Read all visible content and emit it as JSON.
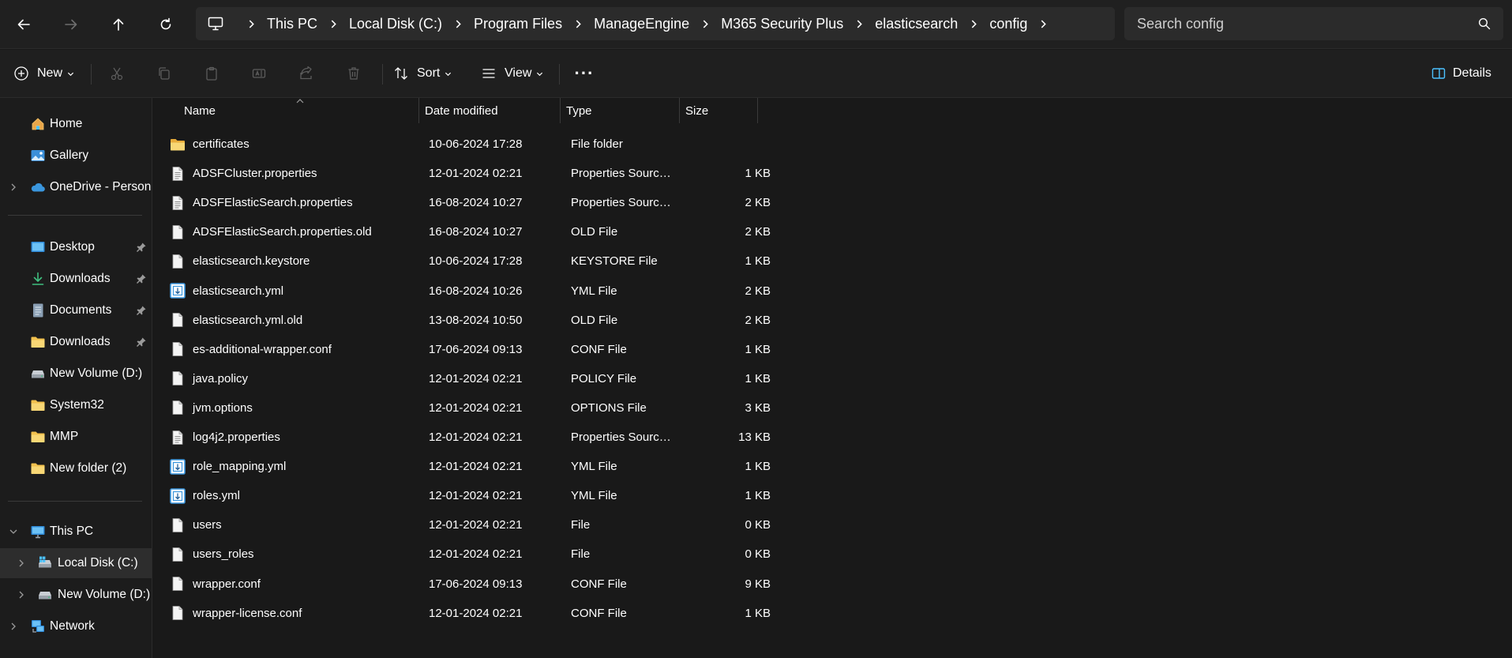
{
  "navigation": {
    "back_icon": "arrow-left-icon",
    "forward_icon": "arrow-right-icon",
    "up_icon": "arrow-up-icon",
    "refresh_icon": "refresh-icon"
  },
  "breadcrumb": [
    "This PC",
    "Local Disk (C:)",
    "Program Files",
    "ManageEngine",
    "M365 Security Plus",
    "elasticsearch",
    "config"
  ],
  "search": {
    "placeholder": "Search config"
  },
  "toolbar": {
    "new_label": "New",
    "sort_label": "Sort",
    "view_label": "View",
    "more_label": "···",
    "details_label": "Details"
  },
  "sidebar": {
    "home": "Home",
    "gallery": "Gallery",
    "onedrive": "OneDrive - Persona",
    "quick_access": [
      {
        "label": "Desktop",
        "icon": "desktop-icon",
        "pinned": true
      },
      {
        "label": "Downloads",
        "icon": "download-icon",
        "pinned": true
      },
      {
        "label": "Documents",
        "icon": "documents-icon",
        "pinned": true
      },
      {
        "label": "Downloads",
        "icon": "folder-icon",
        "pinned": true
      },
      {
        "label": "New Volume (D:)",
        "icon": "drive-icon",
        "pinned": false
      },
      {
        "label": "System32",
        "icon": "folder-icon",
        "pinned": false
      },
      {
        "label": "MMP",
        "icon": "folder-icon",
        "pinned": false
      },
      {
        "label": "New folder (2)",
        "icon": "folder-icon",
        "pinned": false
      }
    ],
    "this_pc": "This PC",
    "local_disk": "Local Disk (C:)",
    "new_volume": "New Volume (D:)",
    "network": "Network"
  },
  "columns": {
    "name": "Name",
    "date": "Date modified",
    "type": "Type",
    "size": "Size"
  },
  "files": [
    {
      "name": "certificates",
      "date": "10-06-2024 17:28",
      "type": "File folder",
      "size": "",
      "icon": "folder-icon"
    },
    {
      "name": "ADSFCluster.properties",
      "date": "12-01-2024 02:21",
      "type": "Properties Source ...",
      "size": "1 KB",
      "icon": "text-file-icon"
    },
    {
      "name": "ADSFElasticSearch.properties",
      "date": "16-08-2024 10:27",
      "type": "Properties Source ...",
      "size": "2 KB",
      "icon": "text-file-icon"
    },
    {
      "name": "ADSFElasticSearch.properties.old",
      "date": "16-08-2024 10:27",
      "type": "OLD File",
      "size": "2 KB",
      "icon": "file-icon"
    },
    {
      "name": "elasticsearch.keystore",
      "date": "10-06-2024 17:28",
      "type": "KEYSTORE File",
      "size": "1 KB",
      "icon": "file-icon"
    },
    {
      "name": "elasticsearch.yml",
      "date": "16-08-2024 10:26",
      "type": "YML File",
      "size": "2 KB",
      "icon": "yml-file-icon"
    },
    {
      "name": "elasticsearch.yml.old",
      "date": "13-08-2024 10:50",
      "type": "OLD File",
      "size": "2 KB",
      "icon": "file-icon"
    },
    {
      "name": "es-additional-wrapper.conf",
      "date": "17-06-2024 09:13",
      "type": "CONF File",
      "size": "1 KB",
      "icon": "file-icon"
    },
    {
      "name": "java.policy",
      "date": "12-01-2024 02:21",
      "type": "POLICY File",
      "size": "1 KB",
      "icon": "file-icon"
    },
    {
      "name": "jvm.options",
      "date": "12-01-2024 02:21",
      "type": "OPTIONS File",
      "size": "3 KB",
      "icon": "file-icon"
    },
    {
      "name": "log4j2.properties",
      "date": "12-01-2024 02:21",
      "type": "Properties Source ...",
      "size": "13 KB",
      "icon": "text-file-icon"
    },
    {
      "name": "role_mapping.yml",
      "date": "12-01-2024 02:21",
      "type": "YML File",
      "size": "1 KB",
      "icon": "yml-file-icon"
    },
    {
      "name": "roles.yml",
      "date": "12-01-2024 02:21",
      "type": "YML File",
      "size": "1 KB",
      "icon": "yml-file-icon"
    },
    {
      "name": "users",
      "date": "12-01-2024 02:21",
      "type": "File",
      "size": "0 KB",
      "icon": "file-icon"
    },
    {
      "name": "users_roles",
      "date": "12-01-2024 02:21",
      "type": "File",
      "size": "0 KB",
      "icon": "file-icon"
    },
    {
      "name": "wrapper.conf",
      "date": "17-06-2024 09:13",
      "type": "CONF File",
      "size": "9 KB",
      "icon": "file-icon"
    },
    {
      "name": "wrapper-license.conf",
      "date": "12-01-2024 02:21",
      "type": "CONF File",
      "size": "1 KB",
      "icon": "file-icon"
    }
  ],
  "colors": {
    "window_bg": "#191919",
    "bar_bg": "#202020",
    "folder": "#f2c14e",
    "accent": "#4cc2ff"
  }
}
